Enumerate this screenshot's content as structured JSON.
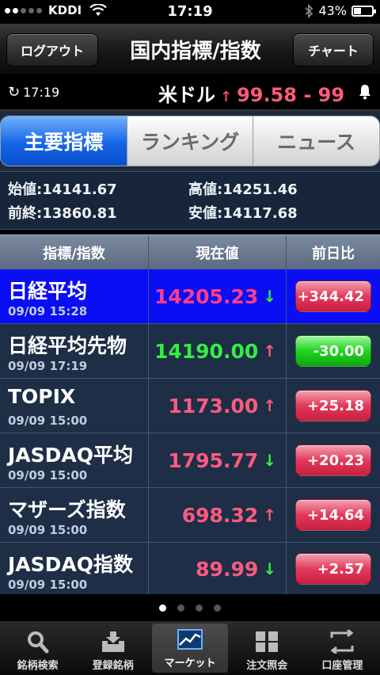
{
  "status_bar": {
    "carrier": "KDDI",
    "time": "17:19",
    "battery": "43%",
    "battery_level": 0.43
  },
  "navbar": {
    "logout_label": "ログアウト",
    "title": "国内指標/指数",
    "chart_label": "チャート"
  },
  "ticker": {
    "time": "17:19",
    "currency": "米ドル",
    "arrow": "↑",
    "value": "99.58 - 9\u0000"
  },
  "tabs": [
    {
      "label": "主要指標",
      "active": true
    },
    {
      "label": "ランキング",
      "active": false
    },
    {
      "label": "ニュース",
      "active": false
    }
  ],
  "summary": {
    "open": "始値:14141.67",
    "high": "高値:14251.46",
    "prev_close": "前終:13860.81",
    "low": "安値:14117.68"
  },
  "table": {
    "headers": [
      "指標/指数",
      "現在値",
      "前日比"
    ],
    "rows": [
      {
        "name": "日経平均",
        "timestamp": "09/09 15:28",
        "value": "14205.23",
        "arrow": "↓",
        "change": "+344.42",
        "change_dir": "up",
        "value_color": "pink",
        "arrow_color": "down",
        "highlight": true
      },
      {
        "name": "日経平均先物",
        "timestamp": "09/09 17:19",
        "value": "14190.00",
        "arrow": "↑",
        "change": "-30.00",
        "change_dir": "down",
        "value_color": "down",
        "arrow_color": "up",
        "highlight": false
      },
      {
        "name": "TOPIX",
        "timestamp": "09/09 15:00",
        "value": "1173.00",
        "arrow": "↑",
        "change": "+25.18",
        "change_dir": "up",
        "value_color": "up",
        "arrow_color": "up",
        "highlight": false
      },
      {
        "name": "JASDAQ平均",
        "timestamp": "09/09 15:00",
        "value": "1795.77",
        "arrow": "↓",
        "change": "+20.23",
        "change_dir": "up",
        "value_color": "up",
        "arrow_color": "down",
        "highlight": false
      },
      {
        "name": "マザーズ指数",
        "timestamp": "09/09 15:00",
        "value": "698.32",
        "arrow": "↑",
        "change": "+14.64",
        "change_dir": "up",
        "value_color": "up",
        "arrow_color": "up",
        "highlight": false
      },
      {
        "name": "JASDAQ指数",
        "timestamp": "09/09 15:00",
        "value": "89.99",
        "arrow": "↓",
        "change": "+2.57",
        "change_dir": "up",
        "value_color": "up",
        "arrow_color": "down",
        "highlight": false
      }
    ]
  },
  "pager": {
    "pages": 4,
    "current": 0
  },
  "tabbar": [
    {
      "label": "銘柄検索",
      "icon": "search-icon",
      "active": false
    },
    {
      "label": "登録銘柄",
      "icon": "download-tray-icon",
      "active": false
    },
    {
      "label": "マーケット",
      "icon": "market-chart-icon",
      "active": true
    },
    {
      "label": "注文照会",
      "icon": "grid-icon",
      "active": false
    },
    {
      "label": "口座管理",
      "icon": "transfer-icon",
      "active": false
    }
  ],
  "colors": {
    "accent_blue": "#1565e6",
    "up": "#ff5a80",
    "down": "#33ee44",
    "highlight_row": "#0a0ef5"
  }
}
